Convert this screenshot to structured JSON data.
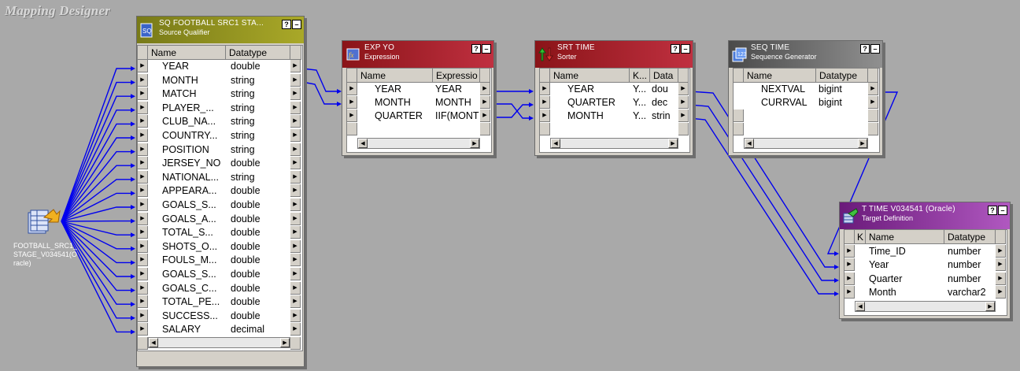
{
  "designer": {
    "title": "Mapping Designer"
  },
  "source": {
    "label": "FOOTBALL_SRC1_STAGE_V034541(Oracle)"
  },
  "sq": {
    "name": "SQ FOOTBALL SRC1 STA...",
    "type": "Source Qualifier",
    "headers": {
      "name": "Name",
      "datatype": "Datatype"
    },
    "ports": [
      {
        "name": "YEAR",
        "datatype": "double"
      },
      {
        "name": "MONTH",
        "datatype": "string"
      },
      {
        "name": "MATCH",
        "datatype": "string"
      },
      {
        "name": "PLAYER_...",
        "datatype": "string"
      },
      {
        "name": "CLUB_NA...",
        "datatype": "string"
      },
      {
        "name": "COUNTRY...",
        "datatype": "string"
      },
      {
        "name": "POSITION",
        "datatype": "string"
      },
      {
        "name": "JERSEY_NO",
        "datatype": "double"
      },
      {
        "name": "NATIONAL...",
        "datatype": "string"
      },
      {
        "name": "APPEARA...",
        "datatype": "double"
      },
      {
        "name": "GOALS_S...",
        "datatype": "double"
      },
      {
        "name": "GOALS_A...",
        "datatype": "double"
      },
      {
        "name": "TOTAL_S...",
        "datatype": "double"
      },
      {
        "name": "SHOTS_O...",
        "datatype": "double"
      },
      {
        "name": "FOULS_M...",
        "datatype": "double"
      },
      {
        "name": "GOALS_S...",
        "datatype": "double"
      },
      {
        "name": "GOALS_C...",
        "datatype": "double"
      },
      {
        "name": "TOTAL_PE...",
        "datatype": "double"
      },
      {
        "name": "SUCCESS...",
        "datatype": "double"
      },
      {
        "name": "SALARY",
        "datatype": "decimal"
      }
    ]
  },
  "exp": {
    "name": "EXP YO",
    "type": "Expression",
    "headers": {
      "name": "Name",
      "expr": "Expressio"
    },
    "ports": [
      {
        "name": "YEAR",
        "expr": "YEAR"
      },
      {
        "name": "MONTH",
        "expr": "MONTH"
      },
      {
        "name": "QUARTER",
        "expr": "IIF(MONT"
      }
    ]
  },
  "srt": {
    "name": "SRT TIME",
    "type": "Sorter",
    "headers": {
      "name": "Name",
      "key": "K...",
      "datatype": "Data"
    },
    "ports": [
      {
        "name": "YEAR",
        "key": "Y...",
        "datatype": "dou"
      },
      {
        "name": "QUARTER",
        "key": "Y...",
        "datatype": "dec"
      },
      {
        "name": "MONTH",
        "key": "Y...",
        "datatype": "strin"
      }
    ]
  },
  "seq": {
    "name": "SEQ TIME",
    "type": "Sequence Generator",
    "headers": {
      "name": "Name",
      "datatype": "Datatype"
    },
    "ports": [
      {
        "name": "NEXTVAL",
        "datatype": "bigint"
      },
      {
        "name": "CURRVAL",
        "datatype": "bigint"
      }
    ]
  },
  "tgt": {
    "name": "T TIME V034541 (Oracle)",
    "type": "Target Definition",
    "headers": {
      "key": "K",
      "name": "Name",
      "datatype": "Datatype"
    },
    "ports": [
      {
        "name": "Time_ID",
        "datatype": "number"
      },
      {
        "name": "Year",
        "datatype": "number"
      },
      {
        "name": "Quarter",
        "datatype": "number"
      },
      {
        "name": "Month",
        "datatype": "varchar2"
      }
    ]
  }
}
